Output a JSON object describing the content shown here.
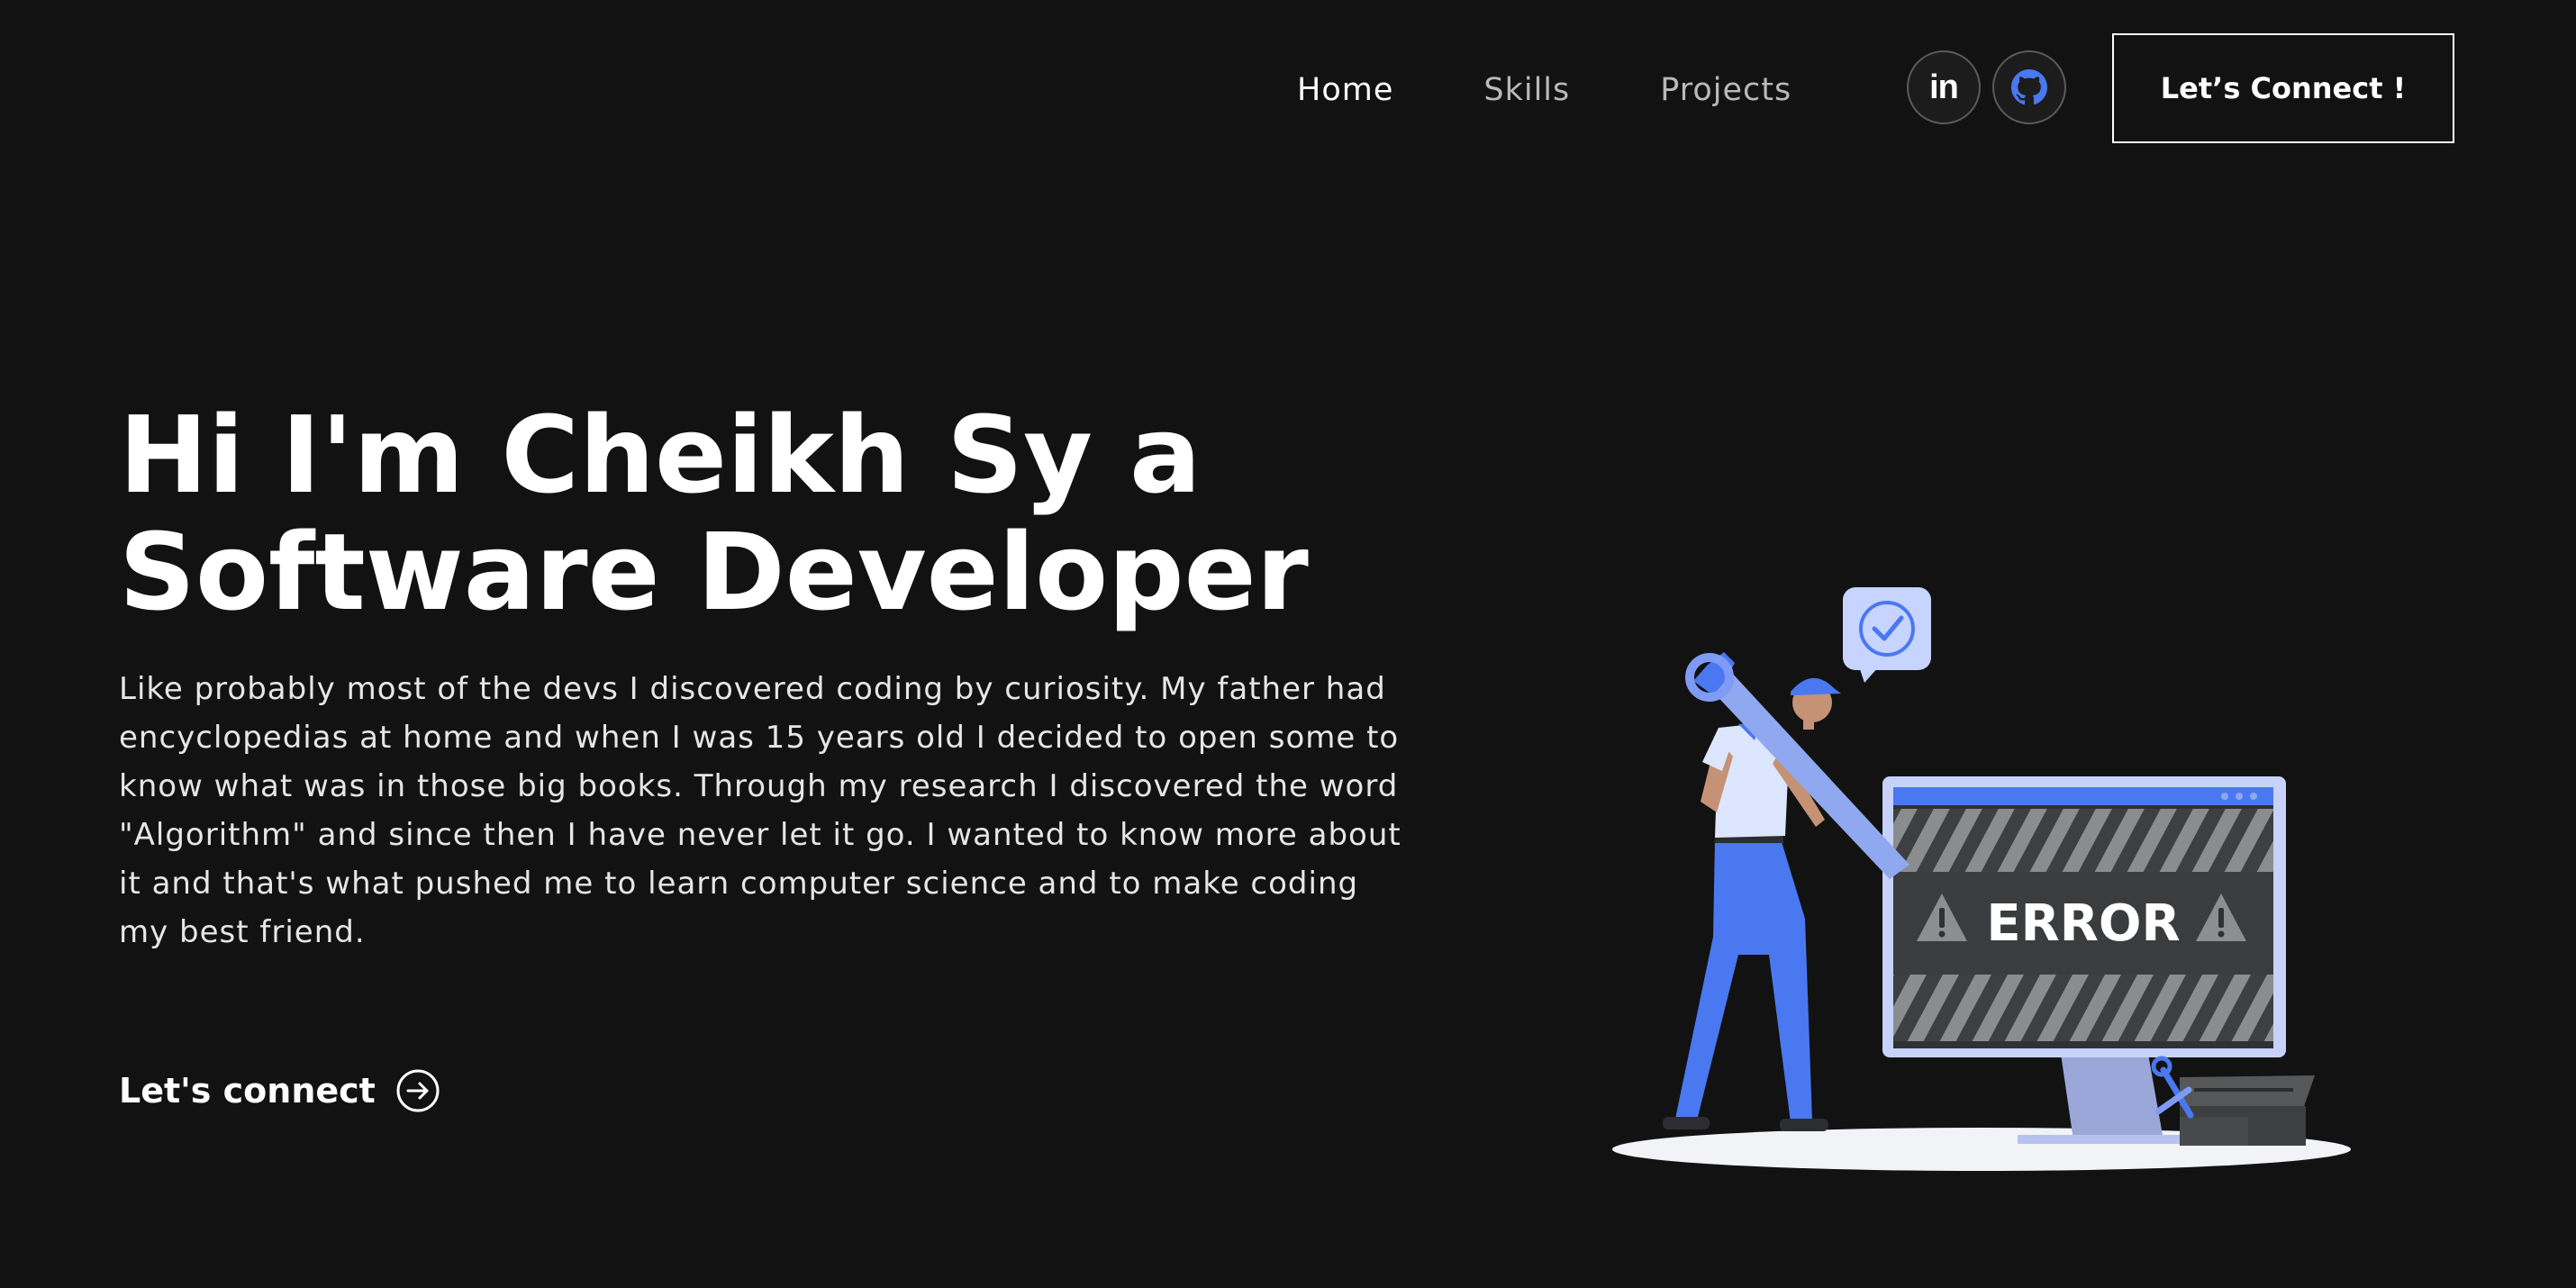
{
  "nav": {
    "links": [
      {
        "label": "Home",
        "active": true
      },
      {
        "label": "Skills",
        "active": false
      },
      {
        "label": "Projects",
        "active": false
      }
    ],
    "social": [
      {
        "icon": "linkedin-icon",
        "text": "in"
      },
      {
        "icon": "github-icon"
      }
    ],
    "cta_label": "Let’s Connect !"
  },
  "hero": {
    "title_line1": "Hi I'm Cheikh Sy a",
    "title_line2": "Software Developer",
    "description": "Like probably most of the devs I discovered coding by curiosity. My father had encyclopedias at home and when I was 15 years old I decided to open some to know what was in those big books. Through my research I discovered the word \"Algorithm\" and since then I have never let it go. I wanted to know more about it and that's what pushed me to learn computer science and to make coding my best friend.",
    "connect_label": "Let's connect",
    "connect_icon": "arrow-right-circle-icon"
  },
  "illustration": {
    "screen_text": "ERROR",
    "icons": [
      "check-icon",
      "warning-icon",
      "wrench-icon"
    ]
  },
  "colors": {
    "background": "#121212",
    "accent": "#4a78f0",
    "accent_light": "#c6d4ff",
    "text": "#ffffff",
    "muted": "#b9b9b9"
  }
}
